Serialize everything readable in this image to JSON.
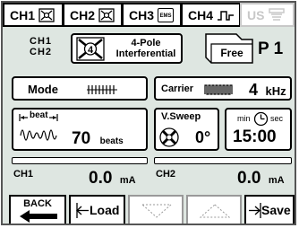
{
  "tabs": [
    {
      "label": "CH1",
      "icon": "electrode-grid-icon"
    },
    {
      "label": "CH2",
      "icon": "electrode-grid-icon"
    },
    {
      "label": "CH3",
      "icon": "ems-icon",
      "icon_text": "EMS"
    },
    {
      "label": "CH4",
      "icon": "pulse-wave-icon"
    },
    {
      "label": "US",
      "icon": "ultrasound-icon",
      "disabled": true
    }
  ],
  "program": {
    "channels": [
      "CH1",
      "CH2"
    ],
    "mode_number": "4",
    "mode_name_line1": "4-Pole",
    "mode_name_line2": "Interferential"
  },
  "memory": {
    "folder_label": "Free",
    "program_label": "P 1"
  },
  "mode": {
    "label": "Mode",
    "pattern_icon": "constant-pulse-icon"
  },
  "carrier": {
    "label": "Carrier",
    "value": "4",
    "unit": "kHz"
  },
  "beat": {
    "label": "beat",
    "value": "70",
    "unit": "beats"
  },
  "vector_sweep": {
    "label": "V.Sweep",
    "value": "0°"
  },
  "timer": {
    "min_label": "min",
    "sec_label": "sec",
    "value": "15:00"
  },
  "intensity": {
    "ch1": {
      "label": "CH1",
      "value": "0.0",
      "unit": "mA",
      "level": 0
    },
    "ch2": {
      "label": "CH2",
      "value": "0.0",
      "unit": "mA",
      "level": 0
    }
  },
  "footer": {
    "back_label": "BACK",
    "load_label": "Load",
    "save_label": "Save"
  },
  "colors": {
    "panel_background": "#dee6e1",
    "disabled": "#c8c8c8"
  }
}
